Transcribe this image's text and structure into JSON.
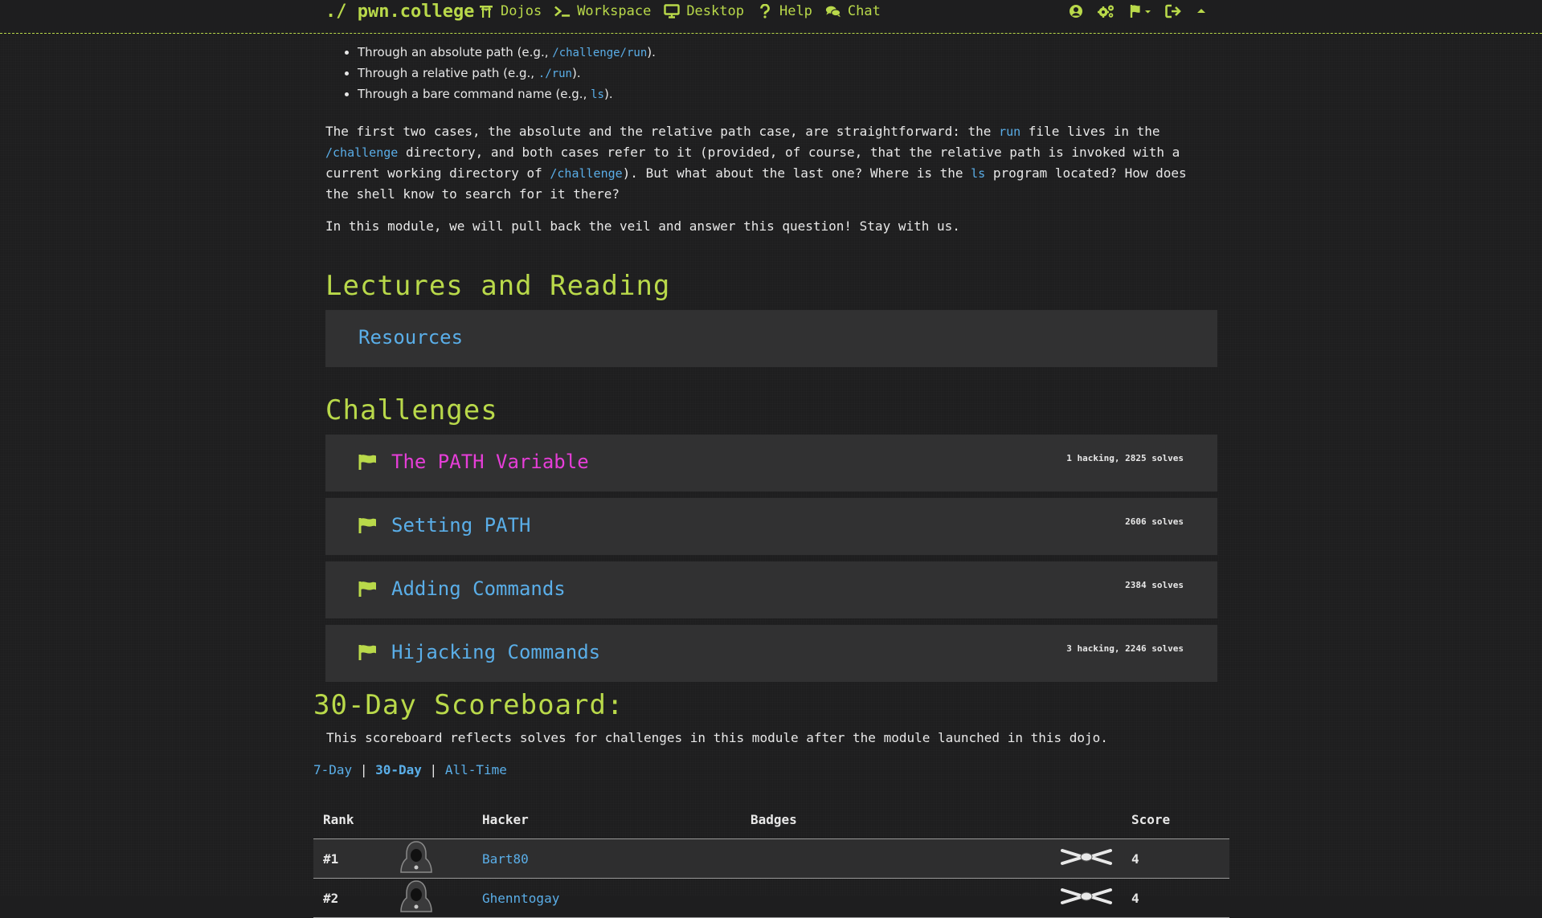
{
  "nav": {
    "brand": "./ pwn.college",
    "links": [
      {
        "label": "Dojos",
        "icon": "torii-gate-icon"
      },
      {
        "label": "Workspace",
        "icon": "terminal-icon"
      },
      {
        "label": "Desktop",
        "icon": "monitor-icon"
      },
      {
        "label": "Help",
        "icon": "question-icon"
      },
      {
        "label": "Chat",
        "icon": "comments-icon"
      }
    ],
    "right_icons": [
      "user-circle-icon",
      "settings-icon",
      "flag-dropdown-icon",
      "logout-icon",
      "caret-up-icon"
    ]
  },
  "intro": {
    "bullets": [
      {
        "pre": "Through an absolute path (e.g., ",
        "code": "/challenge/run",
        "post": ")."
      },
      {
        "pre": "Through a relative path (e.g., ",
        "code": "./run",
        "post": ")."
      },
      {
        "pre": "Through a bare command name (e.g., ",
        "code": "ls",
        "post": ")."
      }
    ],
    "p1": {
      "t1": "The first two cases, the absolute and the relative path case, are straightforward: the ",
      "c1": "run",
      "t2": " file lives in the ",
      "c2": "/challenge",
      "t3": " directory, and both cases refer to it (provided, of course, that the relative path is invoked with a current working directory of ",
      "c3": "/challenge",
      "t4": "). But what about the last one? Where is the ",
      "c4": "ls",
      "t5": " program located? How does the shell know to search for it there?"
    },
    "p2": "In this module, we will pull back the veil and answer this question! Stay with us."
  },
  "lectures": {
    "heading": "Lectures and Reading",
    "items": [
      {
        "title": "Resources"
      }
    ]
  },
  "challenges": {
    "heading": "Challenges",
    "items": [
      {
        "title": "The PATH Variable",
        "stats": "1 hacking, 2825 solves",
        "active": true
      },
      {
        "title": "Setting PATH",
        "stats": "2606 solves",
        "active": false
      },
      {
        "title": "Adding Commands",
        "stats": "2384 solves",
        "active": false
      },
      {
        "title": "Hijacking Commands",
        "stats": "3 hacking, 2246 solves",
        "active": false
      }
    ]
  },
  "scoreboard": {
    "heading": "30-Day Scoreboard:",
    "description": "This scoreboard reflects solves for challenges in this module after the module launched in this dojo.",
    "tabs": [
      {
        "label": "7-Day",
        "current": false
      },
      {
        "label": "30-Day",
        "current": true
      },
      {
        "label": "All-Time",
        "current": false
      }
    ],
    "separator": "|",
    "columns": {
      "rank": "Rank",
      "hacker": "Hacker",
      "badges": "Badges",
      "score": "Score"
    },
    "rows": [
      {
        "rank": "#1",
        "hacker": "Bart80",
        "belt": "white-belt-icon",
        "score": "4"
      },
      {
        "rank": "#2",
        "hacker": "Ghenntogay",
        "belt": "white-belt-icon",
        "score": "4"
      }
    ]
  },
  "colors": {
    "accent": "#b9d94a",
    "link": "#5aaee8",
    "active": "#e63ed8",
    "background": "#1e1e1f",
    "card": "#313132"
  }
}
